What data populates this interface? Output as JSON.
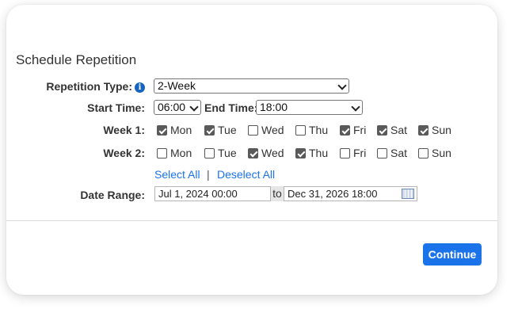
{
  "dialog": {
    "title": "Schedule Repetition",
    "repetition_type": {
      "label": "Repetition Type:",
      "value": "2-Week"
    },
    "start_time": {
      "label": "Start Time:",
      "value": "06:00"
    },
    "end_time": {
      "label": "End Time:",
      "value": "18:00"
    },
    "week1": {
      "label": "Week 1:",
      "days": [
        {
          "name": "Mon",
          "checked": true
        },
        {
          "name": "Tue",
          "checked": true
        },
        {
          "name": "Wed",
          "checked": false
        },
        {
          "name": "Thu",
          "checked": false
        },
        {
          "name": "Fri",
          "checked": true
        },
        {
          "name": "Sat",
          "checked": true
        },
        {
          "name": "Sun",
          "checked": true
        }
      ]
    },
    "week2": {
      "label": "Week 2:",
      "days": [
        {
          "name": "Mon",
          "checked": false
        },
        {
          "name": "Tue",
          "checked": false
        },
        {
          "name": "Wed",
          "checked": true
        },
        {
          "name": "Thu",
          "checked": true
        },
        {
          "name": "Fri",
          "checked": false
        },
        {
          "name": "Sat",
          "checked": false
        },
        {
          "name": "Sun",
          "checked": false
        }
      ]
    },
    "select_all": "Select All",
    "separator": "|",
    "deselect_all": "Deselect All",
    "date_range": {
      "label": "Date Range:",
      "start": "Jul 1, 2024 00:00",
      "to": "to",
      "end": "Dec 31, 2026 18:00"
    },
    "continue_label": "Continue",
    "info_glyph": "i",
    "accent_color": "#1a73e8"
  }
}
